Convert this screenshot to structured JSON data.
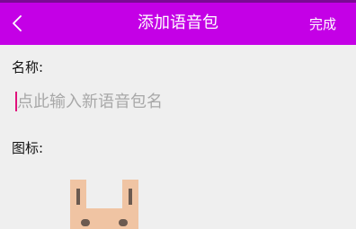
{
  "header": {
    "back_icon": "chevron-left-icon",
    "title": "添加语音包",
    "done_label": "完成",
    "background": "#c400e6",
    "text_color": "#ffffff"
  },
  "form": {
    "name_label": "名称:",
    "name_value": "",
    "name_placeholder": "点此输入新语音包名",
    "caret_color": "#e0117c",
    "icon_label": "图标:",
    "icon_image": "voice-pack-icon"
  }
}
